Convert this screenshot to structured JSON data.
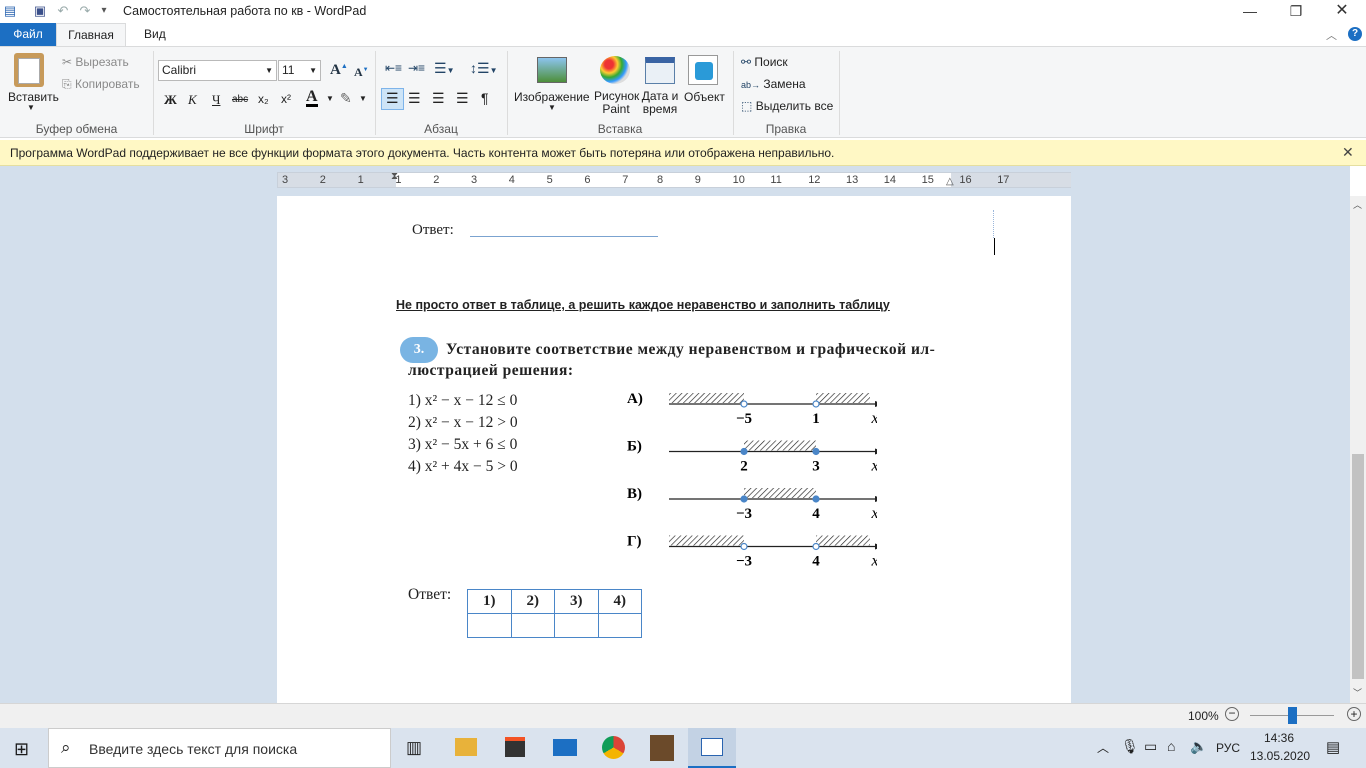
{
  "window": {
    "title": "Самостоятельная работа по кв - WordPad"
  },
  "tabs": {
    "file": "Файл",
    "home": "Главная",
    "view": "Вид"
  },
  "ribbon": {
    "clipboard": {
      "paste": "Вставить",
      "cut": "Вырезать",
      "copy": "Копировать",
      "label": "Буфер обмена"
    },
    "font": {
      "family": "Calibri",
      "size": "11",
      "label": "Шрифт",
      "bold": "Ж",
      "italic": "К",
      "underline": "Ч",
      "strike": "abc",
      "sub": "x₂",
      "sup": "x²"
    },
    "paragraph": {
      "label": "Абзац"
    },
    "insert": {
      "image": "Изображение",
      "paint": "Рисунок Paint",
      "datetime": "Дата и время",
      "object": "Объект",
      "label": "Вставка"
    },
    "editing": {
      "find": "Поиск",
      "replace": "Замена",
      "select_all": "Выделить все",
      "label": "Правка"
    }
  },
  "infobar": {
    "message": "Программа WordPad поддерживает не все функции формата этого документа. Часть контента может быть потеряна или отображена неправильно."
  },
  "ruler": {
    "ticks": [
      "3",
      "2",
      "1",
      "1",
      "2",
      "3",
      "4",
      "5",
      "6",
      "7",
      "8",
      "9",
      "10",
      "11",
      "12",
      "13",
      "14",
      "15",
      "16",
      "17"
    ]
  },
  "document": {
    "answer_label_top": "Ответ:",
    "instruction": "Не просто ответ в таблице, а решить каждое неравенство и заполнить таблицу",
    "task_number": "3.",
    "task_line1": "Установите соответствие между неравенством и графической ил-",
    "task_line2": "люстрацией решения:",
    "inequalities": [
      "1) x² − x − 12 ≤ 0",
      "2) x² − x − 12 > 0",
      "3) x² − 5x + 6 ≤ 0",
      "4) x² + 4x − 5 > 0"
    ],
    "graphs": [
      {
        "label": "А)",
        "left": "−5",
        "right": "1",
        "axis": "x",
        "shade": "outside",
        "closed": false
      },
      {
        "label": "Б)",
        "left": "2",
        "right": "3",
        "axis": "x",
        "shade": "inside",
        "closed": true
      },
      {
        "label": "В)",
        "left": "−3",
        "right": "4",
        "axis": "x",
        "shade": "inside",
        "closed": true
      },
      {
        "label": "Г)",
        "left": "−3",
        "right": "4",
        "axis": "x",
        "shade": "outside",
        "closed": false
      }
    ],
    "answer_label": "Ответ:",
    "answer_headers": [
      "1)",
      "2)",
      "3)",
      "4)"
    ],
    "answer_values": [
      "",
      "",
      "",
      ""
    ]
  },
  "status": {
    "zoom": "100%"
  },
  "taskbar": {
    "search_placeholder": "Введите здесь текст для поиска",
    "lang": "РУС",
    "time": "14:36",
    "date": "13.05.2020"
  }
}
